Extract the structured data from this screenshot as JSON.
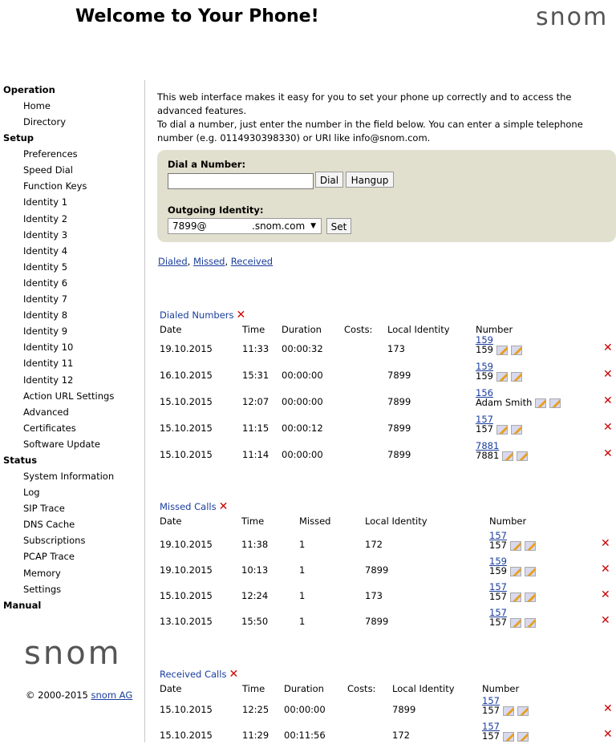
{
  "header": {
    "title": "Welcome to Your Phone!",
    "logo": "snom"
  },
  "sidebar": {
    "sections": [
      {
        "label": "Operation",
        "items": [
          "Home",
          "Directory"
        ]
      },
      {
        "label": "Setup",
        "items": [
          "Preferences",
          "Speed Dial",
          "Function Keys",
          "Identity 1",
          "Identity 2",
          "Identity 3",
          "Identity 4",
          "Identity 5",
          "Identity 6",
          "Identity 7",
          "Identity 8",
          "Identity 9",
          "Identity 10",
          "Identity 11",
          "Identity 12",
          "Action URL Settings",
          "Advanced",
          "Certificates",
          "Software Update"
        ]
      },
      {
        "label": "Status",
        "items": [
          "System Information",
          "Log",
          "SIP Trace",
          "DNS Cache",
          "Subscriptions",
          "PCAP Trace",
          "Memory",
          "Settings"
        ]
      },
      {
        "label": "Manual",
        "items": []
      }
    ],
    "logo": "snom",
    "copyright": "© 2000-2015 ",
    "copyright_link": "snom AG"
  },
  "intro": {
    "line1": "This web interface makes it easy for you to set your phone up correctly and to access the advanced features.",
    "line2": "To dial a number, just enter the number in the field below. You can enter a simple telephone number (e.g. 0114930398330) or URI like info@snom.com."
  },
  "dial": {
    "label": "Dial a Number:",
    "input_value": "",
    "dial_button": "Dial",
    "hangup_button": "Hangup",
    "identity_label": "Outgoing Identity:",
    "identity_user": "7899@",
    "identity_domain": ".snom.com",
    "set_button": "Set"
  },
  "filters": {
    "dialed": "Dialed",
    "missed": "Missed",
    "received": "Received",
    "sep": ", "
  },
  "dialed": {
    "title": "Dialed Numbers",
    "headers": {
      "date": "Date",
      "time": "Time",
      "duration": "Duration",
      "costs": "Costs:",
      "identity": "Local Identity",
      "number": "Number"
    },
    "rows": [
      {
        "date": "19.10.2015",
        "time": "11:33",
        "duration": "00:00:32",
        "identity": "173",
        "link": "159",
        "name": "159"
      },
      {
        "date": "16.10.2015",
        "time": "15:31",
        "duration": "00:00:00",
        "identity": "7899",
        "link": "159",
        "name": "159"
      },
      {
        "date": "15.10.2015",
        "time": "12:07",
        "duration": "00:00:00",
        "identity": "7899",
        "link": "156",
        "name": "Adam Smith"
      },
      {
        "date": "15.10.2015",
        "time": "11:15",
        "duration": "00:00:12",
        "identity": "7899",
        "link": "157",
        "name": "157"
      },
      {
        "date": "15.10.2015",
        "time": "11:14",
        "duration": "00:00:00",
        "identity": "7899",
        "link": "7881",
        "name": "7881"
      }
    ]
  },
  "missed": {
    "title": "Missed Calls",
    "headers": {
      "date": "Date",
      "time": "Time",
      "missed": "Missed",
      "identity": "Local Identity",
      "number": "Number"
    },
    "rows": [
      {
        "date": "19.10.2015",
        "time": "11:38",
        "missed": "1",
        "identity": "172",
        "link": "157",
        "name": "157"
      },
      {
        "date": "19.10.2015",
        "time": "10:13",
        "missed": "1",
        "identity": "7899",
        "link": "159",
        "name": "159"
      },
      {
        "date": "15.10.2015",
        "time": "12:24",
        "missed": "1",
        "identity": "173",
        "link": "157",
        "name": "157"
      },
      {
        "date": "13.10.2015",
        "time": "15:50",
        "missed": "1",
        "identity": "7899",
        "link": "157",
        "name": "157"
      }
    ]
  },
  "received": {
    "title": "Received Calls",
    "headers": {
      "date": "Date",
      "time": "Time",
      "duration": "Duration",
      "costs": "Costs:",
      "identity": "Local Identity",
      "number": "Number"
    },
    "rows": [
      {
        "date": "15.10.2015",
        "time": "12:25",
        "duration": "00:00:00",
        "identity": "7899",
        "link": "157",
        "name": "157"
      },
      {
        "date": "15.10.2015",
        "time": "11:29",
        "duration": "00:11:56",
        "identity": "172",
        "link": "157",
        "name": "157"
      }
    ]
  },
  "icons": {
    "delete": "delete-x-icon",
    "edit": "edit-pencil-icon"
  },
  "colors": {
    "link": "#1a3d9e",
    "delete": "#cc0000",
    "dial_box": "#e1dfcd"
  }
}
